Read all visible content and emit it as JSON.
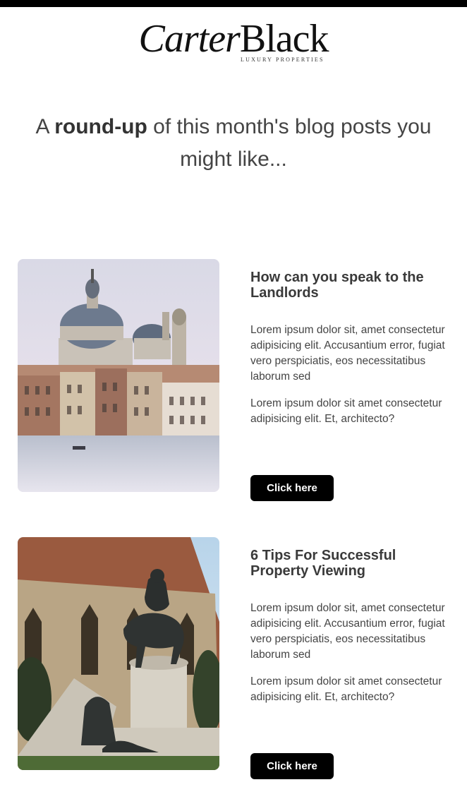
{
  "logo": {
    "name_italic": "Carter",
    "name_roman": "Black",
    "tagline": "LUXURY PROPERTIES"
  },
  "intro": {
    "prefix": "A ",
    "bold": "round-up",
    "suffix": " of this month's blog posts you might like..."
  },
  "posts": [
    {
      "title": "How can you speak to the Landlords",
      "paragraph1": "Lorem ipsum dolor sit, amet consectetur adipisicing elit. Accusantium error, fugiat vero perspiciatis, eos necessitatibus laborum sed",
      "paragraph2": "Lorem ipsum dolor sit amet consectetur adipisicing elit. Et, architecto?",
      "button_label": "Click here",
      "image": "venice-grand-canal-photo"
    },
    {
      "title": "6 Tips For Successful Property Viewing",
      "paragraph1": "Lorem ipsum dolor sit, amet consectetur adipisicing elit. Accusantium error, fugiat vero perspiciatis, eos necessitatibus laborum sed",
      "paragraph2": "Lorem ipsum dolor sit amet consectetur adipisicing elit. Et, architecto?",
      "button_label": "Click here",
      "image": "equestrian-statue-church-photo"
    }
  ]
}
